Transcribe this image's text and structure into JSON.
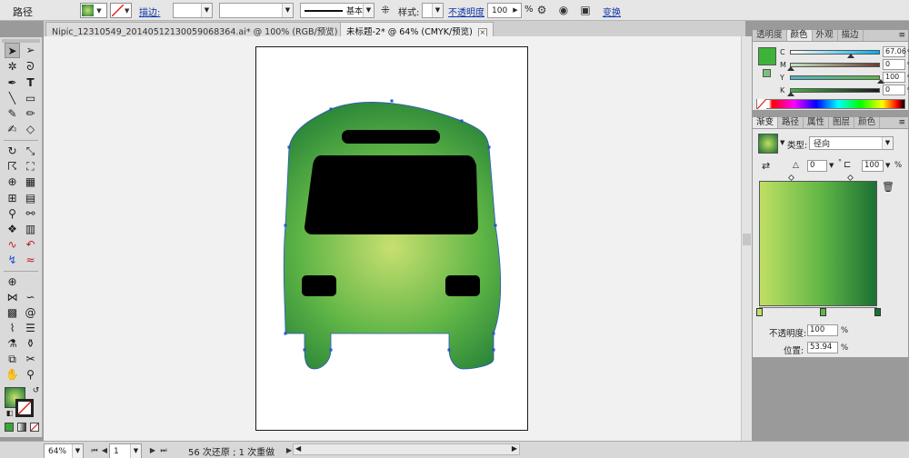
{
  "control_bar": {
    "object_type": "路径",
    "stroke_link": "描边:",
    "stroke_weight": "",
    "brush_definition": "",
    "stroke_profile": "基本",
    "style_label": "样式:",
    "opacity_link": "不透明度",
    "opacity_value": "100",
    "opacity_unit": "%",
    "transform_link": "变换",
    "fill_color": "#3aa63a",
    "link_color": "#1033a8"
  },
  "tabs": [
    {
      "label": "Nipic_12310549_20140512130059068364.ai* @ 100% (RGB/预览)",
      "active": false
    },
    {
      "label": "未标题-2* @ 64% (CMYK/预览)",
      "active": true
    }
  ],
  "tools": [
    "selection-tool",
    "direct-selection-tool",
    "magic-wand-tool",
    "lasso-tool",
    "pen-tool",
    "type-tool",
    "line-tool",
    "rectangle-tool",
    "paintbrush-tool",
    "pencil-tool",
    "blob-brush-tool",
    "eraser-tool",
    "rotate-tool",
    "scale-tool",
    "warp-tool",
    "free-transform-tool",
    "shape-builder-tool",
    "perspective-grid-tool",
    "mesh-tool",
    "gradient-tool",
    "eyedropper-tool",
    "blend-tool",
    "symbol-sprayer-tool",
    "column-graph-tool",
    "artboard-tool",
    "slice-tool",
    "hand-tool",
    "zoom-tool"
  ],
  "bus": {
    "body_center": "#c8e070",
    "body_mid": "#5fb546",
    "body_edge": "#1d7a35",
    "outline": "#2a54c8",
    "glass": "#000000"
  },
  "status": {
    "zoom": "64%",
    "artboard_number": "1",
    "history": "56 次还原 ; 1 次重做"
  },
  "color_panel": {
    "tabs": [
      "透明度",
      "颜色",
      "外观",
      "描边"
    ],
    "active_tab": "颜色",
    "swatch": "#3db33a",
    "channels": [
      {
        "label": "C",
        "value": "67.06",
        "knob": 0.67,
        "from": "#ffffff",
        "to": "#00aeef"
      },
      {
        "label": "M",
        "value": "0",
        "knob": 0.0,
        "from": "#c5e4c2",
        "to": "#6b3d2e"
      },
      {
        "label": "Y",
        "value": "100",
        "knob": 1.0,
        "from": "#4fb3c9",
        "to": "#63b545"
      },
      {
        "label": "K",
        "value": "0",
        "knob": 0.0,
        "from": "#47b046",
        "to": "#1a1a1a"
      }
    ],
    "unit": "%"
  },
  "gradient_panel": {
    "tabs": [
      "渐变",
      "路径",
      "属性",
      "图层",
      "颜色"
    ],
    "active_tab": "渐变",
    "type_label": "类型:",
    "type_value": "径向",
    "angle": "0",
    "aspect": "100",
    "aspect_unit": "%",
    "opacity_label": "不透明度:",
    "opacity_value": "100",
    "location_label": "位置:",
    "location_value": "53.94",
    "unit": "%",
    "start_color": "#bfe063",
    "end_color": "#1b7033",
    "stops": [
      {
        "position": 0.0,
        "color": "#bfe063"
      },
      {
        "position": 0.54,
        "color": "#5fb546"
      },
      {
        "position": 1.0,
        "color": "#1b7033"
      }
    ]
  }
}
